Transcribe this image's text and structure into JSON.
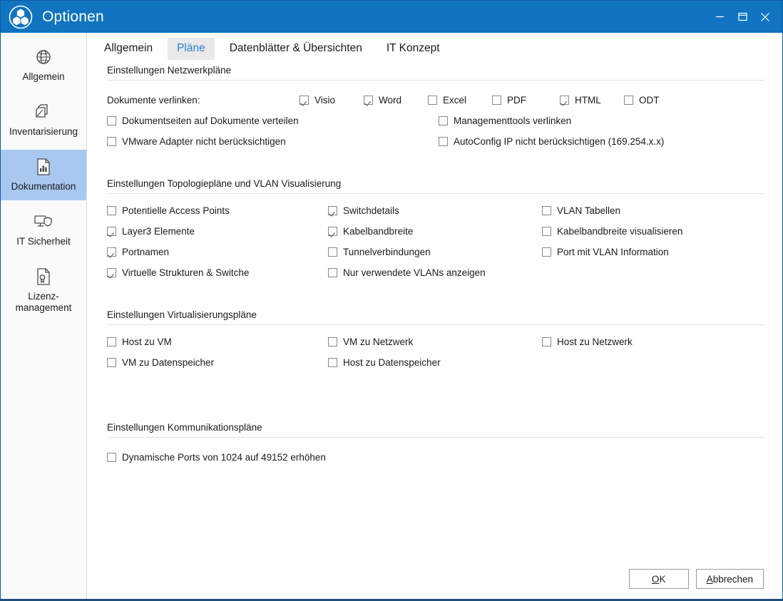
{
  "window": {
    "title": "Optionen",
    "logo_icon": "three-hexagons-circle-logo",
    "controls": [
      {
        "name": "minimize-button",
        "icon": "minimize-icon"
      },
      {
        "name": "restore-button",
        "icon": "restore-window-icon"
      },
      {
        "name": "close-button",
        "icon": "close-icon"
      }
    ],
    "colors": {
      "titlebar": "#1074c0",
      "accent": "#2a7fd0",
      "sidebar_selected": "#a8c8f0",
      "tab_active_bg": "#e9e9e9"
    }
  },
  "sidebar": {
    "items": [
      {
        "label": "Allgemein",
        "icon": "globe-icon",
        "active": false
      },
      {
        "label": "Inventarisierung",
        "icon": "stacked-pages-icon",
        "active": false
      },
      {
        "label": "Dokumentation",
        "icon": "document-chart-icon",
        "active": true
      },
      {
        "label": "IT Sicherheit",
        "icon": "monitor-shield-icon",
        "active": false
      },
      {
        "label": "Lizenz-\nmanagement",
        "label_line1": "Lizenz-",
        "label_line2": "management",
        "icon": "document-certificate-icon",
        "active": false
      }
    ]
  },
  "tabs": [
    {
      "label": "Allgemein",
      "active": false
    },
    {
      "label": "Pläne",
      "active": true
    },
    {
      "label": "Datenblätter & Übersichten",
      "active": false
    },
    {
      "label": "IT Konzept",
      "active": false
    }
  ],
  "sections": {
    "netzwerkplaene": {
      "title": "Einstellungen Netzwerkpläne",
      "link_documents_label": "Dokumente verlinken:",
      "formats": [
        {
          "label": "Visio",
          "checked": true
        },
        {
          "label": "Word",
          "checked": true
        },
        {
          "label": "Excel",
          "checked": false
        },
        {
          "label": "PDF",
          "checked": false
        },
        {
          "label": "HTML",
          "checked": true
        },
        {
          "label": "ODT",
          "checked": false
        }
      ],
      "options_left": [
        {
          "label": "Dokumentseiten auf Dokumente verteilen",
          "checked": false
        },
        {
          "label": "VMware Adapter nicht berücksichtigen",
          "checked": false
        }
      ],
      "options_right": [
        {
          "label": "Managementtools verlinken",
          "checked": false
        },
        {
          "label": "AutoConfig IP nicht berücksichtigen (169.254.x.x)",
          "checked": false
        }
      ]
    },
    "topologie": {
      "title": "Einstellungen Topologiepläne und VLAN Visualisierung",
      "col1": [
        {
          "label": "Potentielle Access Points",
          "checked": false
        },
        {
          "label": "Layer3 Elemente",
          "checked": true
        },
        {
          "label": "Portnamen",
          "checked": true
        },
        {
          "label": "Virtuelle Strukturen & Switche",
          "checked": true
        }
      ],
      "col2": [
        {
          "label": "Switchdetails",
          "checked": true
        },
        {
          "label": "Kabelbandbreite",
          "checked": true
        },
        {
          "label": "Tunnelverbindungen",
          "checked": false
        },
        {
          "label": "Nur verwendete VLANs anzeigen",
          "checked": false
        }
      ],
      "col3": [
        {
          "label": "VLAN Tabellen",
          "checked": false
        },
        {
          "label": "Kabelbandbreite visualisieren",
          "checked": false
        },
        {
          "label": "Port mit VLAN Information",
          "checked": false
        }
      ]
    },
    "virtualisierung": {
      "title": "Einstellungen Virtualisierungspläne",
      "col1": [
        {
          "label": "Host zu VM",
          "checked": false
        },
        {
          "label": "VM zu Datenspeicher",
          "checked": false
        }
      ],
      "col2": [
        {
          "label": "VM zu Netzwerk",
          "checked": false
        },
        {
          "label": "Host zu Datenspeicher",
          "checked": false
        }
      ],
      "col3": [
        {
          "label": "Host zu Netzwerk",
          "checked": false
        }
      ]
    },
    "kommunikation": {
      "title": "Einstellungen Kommunikationspläne",
      "options": [
        {
          "label": "Dynamische Ports von 1024 auf 49152 erhöhen",
          "checked": false
        }
      ]
    }
  },
  "footer": {
    "ok": {
      "accel": "O",
      "rest": "K"
    },
    "cancel": {
      "accel": "A",
      "rest": "bbrechen"
    }
  }
}
